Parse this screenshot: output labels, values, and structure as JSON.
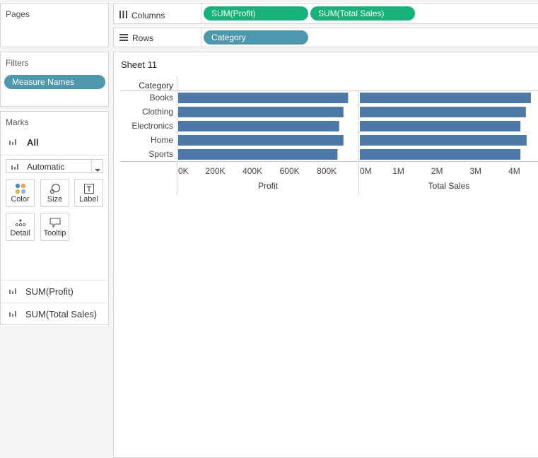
{
  "pages": {
    "title": "Pages"
  },
  "filters": {
    "title": "Filters",
    "pills": [
      "Measure Names"
    ]
  },
  "marks": {
    "title": "Marks",
    "all_label": "All",
    "type_select": "Automatic",
    "buttons": [
      "Color",
      "Size",
      "Label",
      "Detail",
      "Tooltip"
    ],
    "fields": [
      "SUM(Profit)",
      "SUM(Total Sales)"
    ]
  },
  "columns": {
    "label": "Columns",
    "pills": [
      "SUM(Profit)",
      "SUM(Total Sales)"
    ]
  },
  "rows": {
    "label": "Rows",
    "pills": [
      "Category"
    ]
  },
  "sheet": {
    "title": "Sheet 11",
    "row_header": "Category"
  },
  "colors": {
    "bar": "#4e79a7",
    "measure_pill": "#16b378",
    "dimension_pill": "#4d98ad"
  },
  "chart_data": [
    {
      "type": "bar",
      "orientation": "horizontal",
      "categories": [
        "Books",
        "Clothing",
        "Electronics",
        "Home",
        "Sports"
      ],
      "values": [
        915000,
        890000,
        867000,
        890000,
        858000
      ],
      "xlabel": "Profit",
      "ylabel": "Category",
      "xlim": [
        0,
        925000
      ],
      "ticks": [
        "0K",
        "200K",
        "400K",
        "600K",
        "800K"
      ],
      "tick_values": [
        0,
        200000,
        400000,
        600000,
        800000
      ]
    },
    {
      "type": "bar",
      "orientation": "horizontal",
      "categories": [
        "Books",
        "Clothing",
        "Electronics",
        "Home",
        "Sports"
      ],
      "values": [
        4430000,
        4300000,
        4160000,
        4320000,
        4160000
      ],
      "xlabel": "Total Sales",
      "ylabel": "Category",
      "xlim": [
        0,
        4450000
      ],
      "ticks": [
        "0M",
        "1M",
        "2M",
        "3M",
        "4M"
      ],
      "tick_values": [
        0,
        1000000,
        2000000,
        3000000,
        4000000
      ]
    }
  ]
}
